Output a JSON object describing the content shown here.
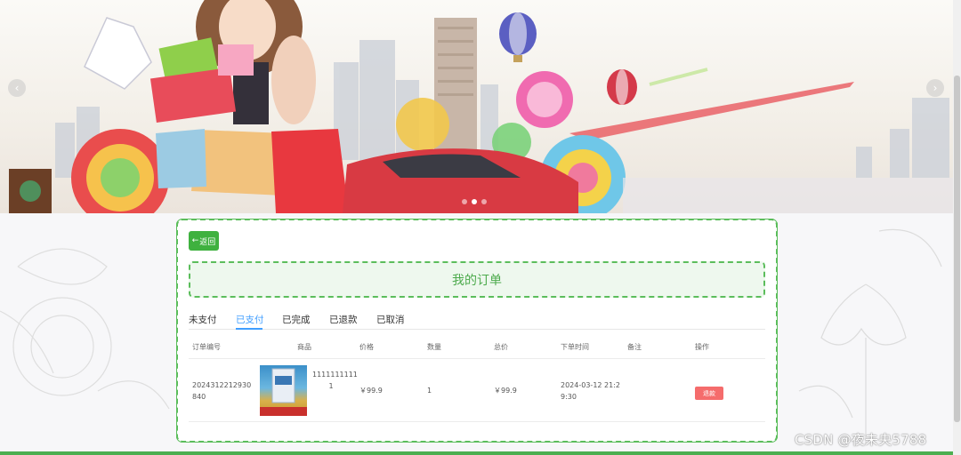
{
  "carousel": {
    "prev_icon": "‹",
    "next_icon": "›",
    "dots": 3,
    "active_dot": 1
  },
  "panel": {
    "back_icon": "←",
    "back_label": "返回",
    "title": "我的订单"
  },
  "tabs": [
    {
      "label": "未支付",
      "active": false
    },
    {
      "label": "已支付",
      "active": true
    },
    {
      "label": "已完成",
      "active": false
    },
    {
      "label": "已退款",
      "active": false
    },
    {
      "label": "已取消",
      "active": false
    }
  ],
  "table": {
    "headers": [
      "订单编号",
      "商品",
      "价格",
      "数量",
      "总价",
      "下单时间",
      "备注",
      "操作"
    ],
    "rows": [
      {
        "order_no_line1": "2024312212930",
        "order_no_line2": "840",
        "product_name_line1": "1111111111",
        "product_name_line2": "1",
        "price": "￥99.9",
        "quantity": "1",
        "total": "￥99.9",
        "time_line1": "2024-03-12 21:2",
        "time_line2": "9:30",
        "remark": "",
        "action_label": "退款"
      }
    ]
  },
  "watermark": "CSDN @夜未央5788",
  "colors": {
    "accent_green": "#3fb13f",
    "tab_active": "#409eff",
    "refund_red": "#f56c6c"
  }
}
